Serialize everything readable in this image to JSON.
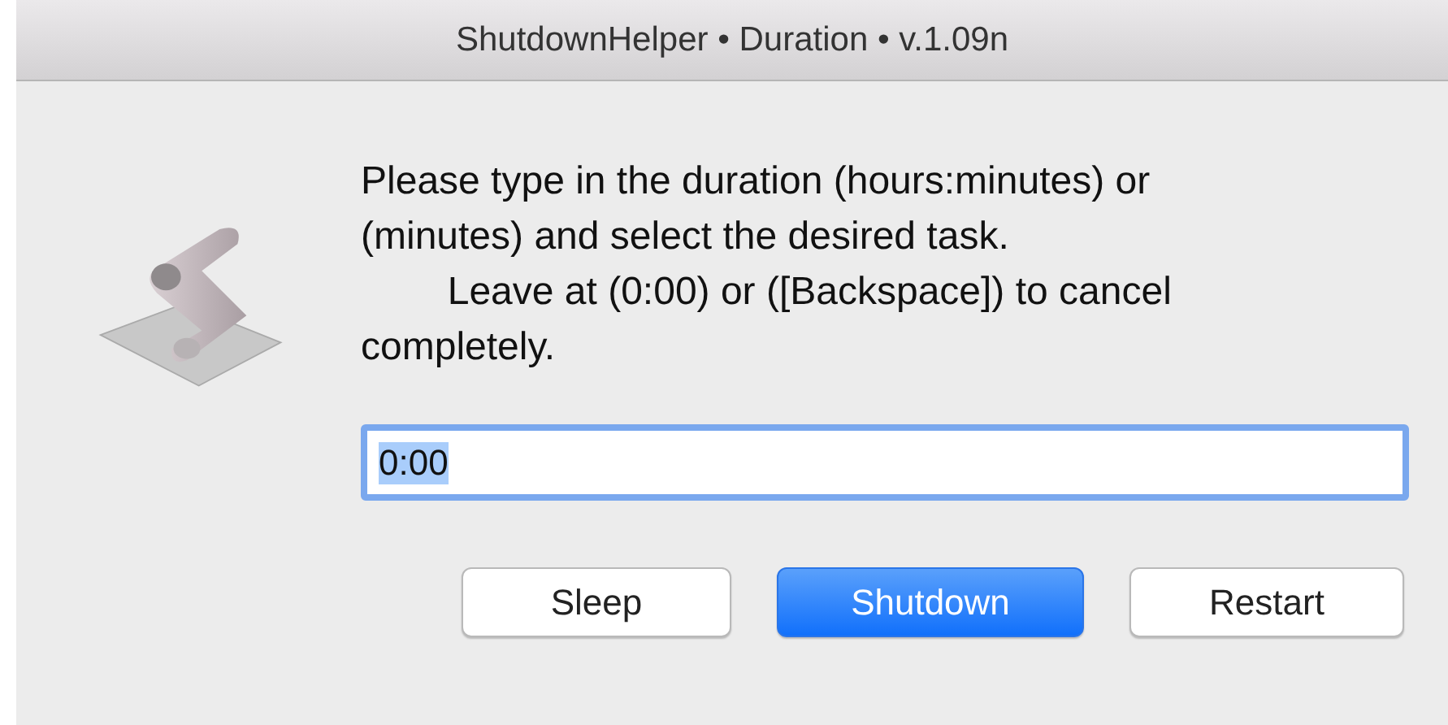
{
  "window": {
    "title": "ShutdownHelper • Duration • v.1.09n"
  },
  "message": "Please type in the duration (hours:minutes) or (minutes) and select the desired task.\n        Leave at (0:00) or ([Backspace]) to cancel completely.",
  "field": {
    "value": "0:00",
    "focused": true,
    "text_selected": true
  },
  "buttons": [
    {
      "label": "Sleep",
      "default": false
    },
    {
      "label": "Shutdown",
      "default": true
    },
    {
      "label": "Restart",
      "default": false
    }
  ]
}
